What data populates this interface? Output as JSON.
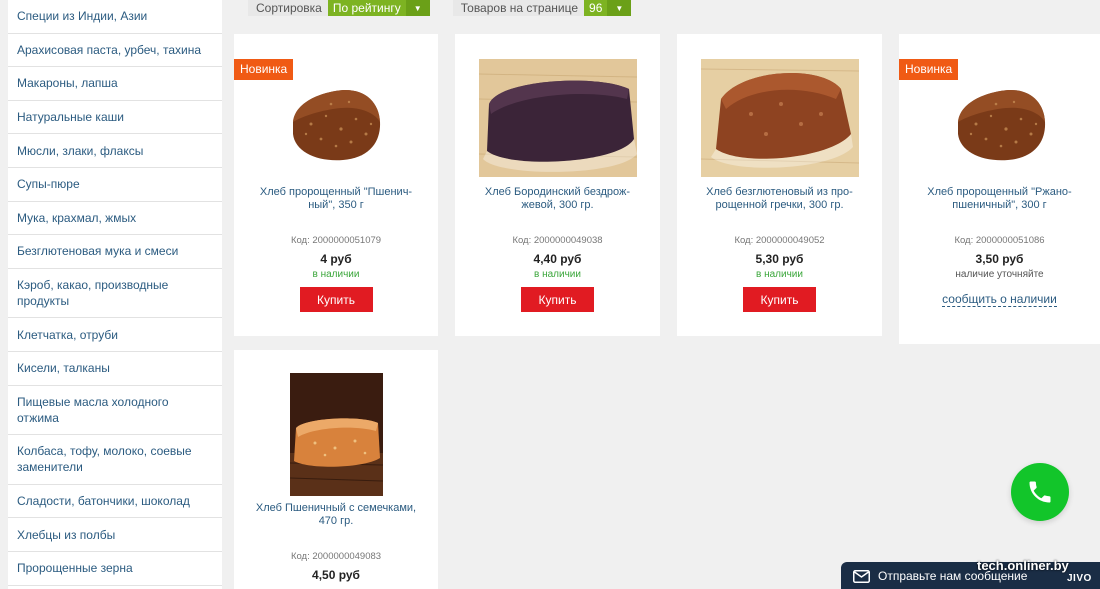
{
  "sidebar": {
    "items": [
      {
        "label": "Специи из Индии, Азии"
      },
      {
        "label": "Арахисовая паста, урбеч, тахина"
      },
      {
        "label": "Макароны, лапша"
      },
      {
        "label": "Натуральные каши"
      },
      {
        "label": "Мюсли, злаки, флаксы"
      },
      {
        "label": "Супы-пюре"
      },
      {
        "label": "Мука, крахмал, жмых"
      },
      {
        "label": "Безглютеновая мука и смеси"
      },
      {
        "label": "Кэроб, какао, производные продукты"
      },
      {
        "label": "Клетчатка, отруби"
      },
      {
        "label": "Кисели, талканы"
      },
      {
        "label": "Пищевые масла холодного отжима"
      },
      {
        "label": "Колбаса, тофу, молоко, соевые заменители"
      },
      {
        "label": "Сладости, батончики, шоколад"
      },
      {
        "label": "Хлебцы из полбы"
      },
      {
        "label": "Пророщенные зерна"
      }
    ]
  },
  "toolbar": {
    "sort_label": "Сортировка",
    "sort_value": "По рейтингу",
    "per_page_label": "Товаров на странице",
    "per_page_value": "96"
  },
  "products": [
    {
      "badge": "Новинка",
      "name": "Хлеб пророщенный \"Пшенич-ный\", 350 г",
      "code": "Код: 2000000051079",
      "price": "4 руб",
      "stock": "в наличии",
      "buy": "Купить"
    },
    {
      "name": "Хлеб Бородинский бездрож-жевой, 300 гр.",
      "code": "Код: 2000000049038",
      "price": "4,40 руб",
      "stock": "в наличии",
      "buy": "Купить"
    },
    {
      "name": "Хлеб безглютеновый из про-рощенной гречки, 300 гр.",
      "code": "Код: 2000000049052",
      "price": "5,30 руб",
      "stock": "в наличии",
      "buy": "Купить"
    },
    {
      "badge": "Новинка",
      "name": "Хлеб пророщенный \"Ржано-пшеничный\", 300 г",
      "code": "Код: 2000000051086",
      "price": "3,50 руб",
      "stock": "наличие уточняйте",
      "notify": "сообщить о наличии"
    },
    {
      "name": "Хлеб Пшеничный с семечками, 470 гр.",
      "code": "Код: 2000000049083",
      "price": "4,50 руб"
    }
  ],
  "chat": {
    "message": "Отправьте нам сообщение",
    "brand": "JIVO",
    "watermark": "tech.onliner.by"
  },
  "colors": {
    "accent_green": "#7db322",
    "buy_red": "#e11b22",
    "badge_orange": "#f05a14",
    "link_blue": "#2b5b80",
    "phone_green": "#12c52a",
    "chat_bg": "#1a2d45"
  },
  "icons": {
    "phone": "phone-icon",
    "chat": "envelope-icon",
    "caret": "caret-down-icon"
  }
}
